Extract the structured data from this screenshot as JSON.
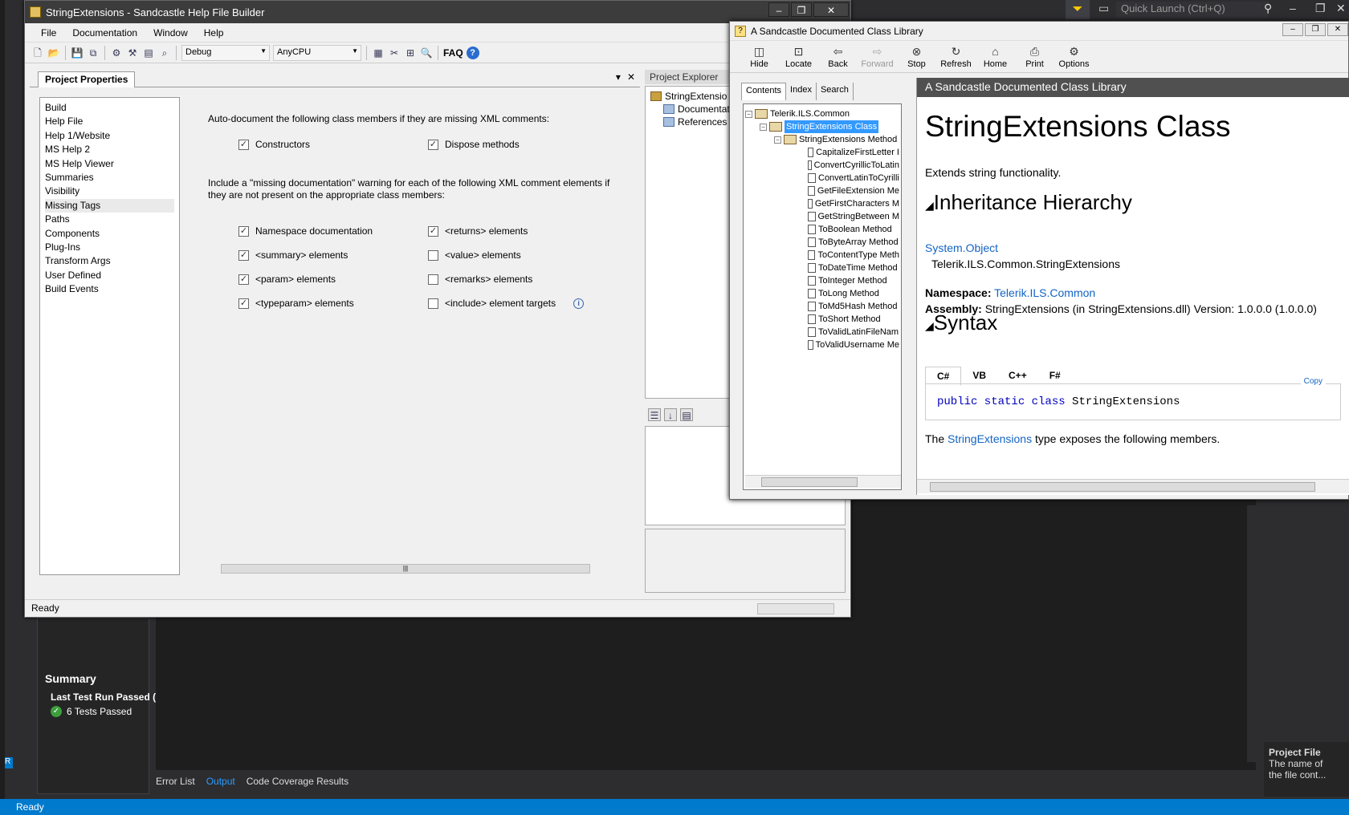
{
  "vs": {
    "quick_launch": "Quick Launch (Ctrl+Q)",
    "summary_title": "Summary",
    "summary_last": "Last Test Run Passed (",
    "summary_tests": "6 Tests Passed",
    "bottom_tabs": [
      "Error List",
      "Output",
      "Code Coverage Results"
    ],
    "project_file_title": "Project File",
    "project_file_desc_1": "The name of",
    "project_file_desc_2": "the file cont...",
    "status": "Ready",
    "r_badge": "R"
  },
  "shfb": {
    "title": "StringExtensions - Sandcastle Help File Builder",
    "menu": [
      "File",
      "Documentation",
      "Window",
      "Help"
    ],
    "config": "Debug",
    "platform": "AnyCPU",
    "faq": "FAQ",
    "tab": "Project Properties",
    "nav": [
      "Build",
      "Help File",
      "Help 1/Website",
      "MS Help 2",
      "MS Help Viewer",
      "Summaries",
      "Visibility",
      "Missing Tags",
      "Paths",
      "Components",
      "Plug-Ins",
      "Transform Args",
      "User Defined",
      "Build Events"
    ],
    "selected_nav": "Missing Tags",
    "auto_doc_text": "Auto-document the following class members if they are missing XML comments:",
    "auto_doc_items": [
      {
        "label": "Constructors",
        "checked": true
      },
      {
        "label": "Dispose methods",
        "checked": true
      }
    ],
    "missing_text_1": "Include a \"missing documentation\" warning for each of the following XML comment elements if",
    "missing_text_2": "they are not present on the appropriate class members:",
    "missing_items": [
      {
        "label": "Namespace documentation",
        "checked": true
      },
      {
        "label": "<returns> elements",
        "checked": true
      },
      {
        "label": "<summary> elements",
        "checked": true
      },
      {
        "label": "<value> elements",
        "checked": false
      },
      {
        "label": "<param> elements",
        "checked": true
      },
      {
        "label": "<remarks> elements",
        "checked": false
      },
      {
        "label": "<typeparam> elements",
        "checked": true
      },
      {
        "label": "<include> element targets",
        "checked": false
      }
    ],
    "status": "Ready",
    "project_explorer": {
      "title": "Project Explorer",
      "nodes": [
        "StringExtensio",
        "Documentati",
        "References"
      ]
    }
  },
  "hv": {
    "title": "A Sandcastle Documented Class Library",
    "toolbar": [
      {
        "label": "Hide",
        "icon": "hide-icon",
        "enabled": true
      },
      {
        "label": "Locate",
        "icon": "locate-icon",
        "enabled": true
      },
      {
        "label": "Back",
        "icon": "back-icon",
        "enabled": true
      },
      {
        "label": "Forward",
        "icon": "forward-icon",
        "enabled": false
      },
      {
        "label": "Stop",
        "icon": "stop-icon",
        "enabled": true
      },
      {
        "label": "Refresh",
        "icon": "refresh-icon",
        "enabled": true
      },
      {
        "label": "Home",
        "icon": "home-icon",
        "enabled": true
      },
      {
        "label": "Print",
        "icon": "print-icon",
        "enabled": true
      },
      {
        "label": "Options",
        "icon": "options-icon",
        "enabled": true
      }
    ],
    "tabs": [
      "Contents",
      "Index",
      "Search"
    ],
    "tree_root": "Telerik.ILS.Common",
    "tree_class": "StringExtensions Class",
    "tree_methods": "StringExtensions Method",
    "tree_items": [
      "CapitalizeFirstLetter I",
      "ConvertCyrillicToLatin",
      "ConvertLatinToCyrilli",
      "GetFileExtension Me",
      "GetFirstCharacters M",
      "GetStringBetween M",
      "ToBoolean Method",
      "ToByteArray Method",
      "ToContentType Meth",
      "ToDateTime Method",
      "ToInteger Method",
      "ToLong Method",
      "ToMd5Hash Method",
      "ToShort Method",
      "ToValidLatinFileNam",
      "ToValidUsername Me"
    ],
    "content": {
      "header": "A Sandcastle Documented Class Library",
      "h1": "StringExtensions Class",
      "summary": "Extends string functionality.",
      "inheritance_title": "Inheritance Hierarchy",
      "inh_base": "System.Object",
      "inh_class": "Telerik.ILS.Common.StringExtensions",
      "ns_label": "Namespace:",
      "ns_value": "Telerik.ILS.Common",
      "asm_label": "Assembly:",
      "asm_value": "StringExtensions (in StringExtensions.dll) Version: 1.0.0.0 (1.0.0.0)",
      "syntax_title": "Syntax",
      "code_tabs": [
        "C#",
        "VB",
        "C++",
        "F#"
      ],
      "copy": "Copy",
      "code_kw": "public static class",
      "code_name": "StringExtensions",
      "members_pre": "The",
      "members_link": "StringExtensions",
      "members_post": "type exposes the following members."
    }
  }
}
